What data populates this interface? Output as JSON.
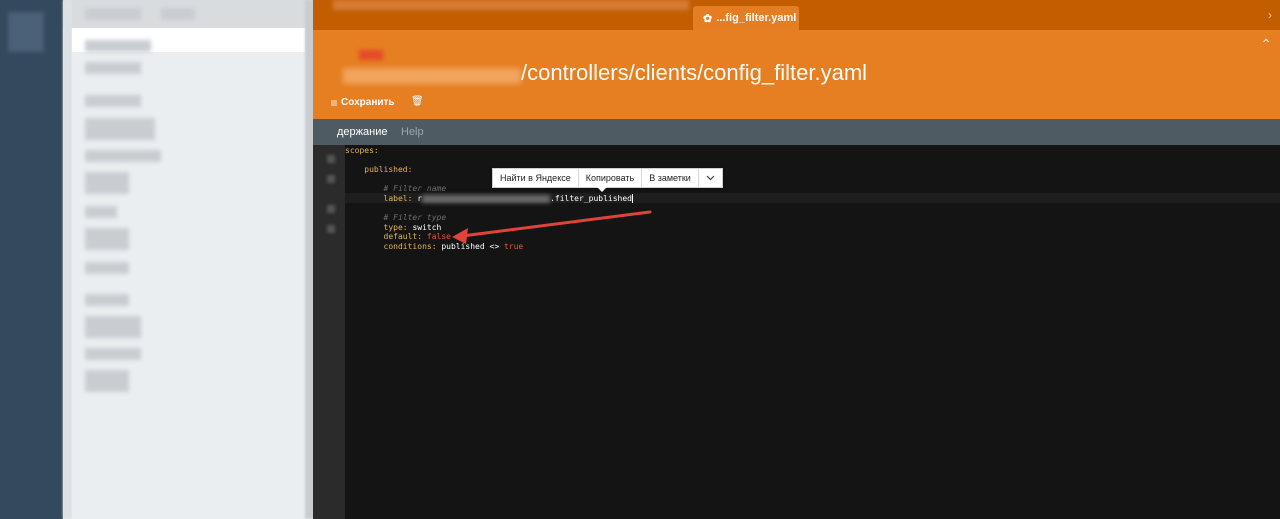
{
  "editor": {
    "tab": {
      "label": "...fig_filter.yaml",
      "icon": "cms-logo-icon"
    },
    "header": {
      "title": "/controllers/clients/config_filter.yaml",
      "save_label": "Сохранить",
      "trash_icon": "trash-icon"
    },
    "subtabs": {
      "active": "держание",
      "help": "Help"
    },
    "code": {
      "scopes_key": "scopes:",
      "published_key": "published:",
      "comment_name": "# Filter name",
      "label_key": "label:",
      "label_prefix": "r",
      "label_suffix": ".filter_published",
      "comment_type": "# Filter type",
      "type_key": "type:",
      "type_value": "switch",
      "default_key": "default:",
      "default_value": "false",
      "conditions_key": "conditions:",
      "conditions_value": "published <>",
      "conditions_bool": "true"
    }
  },
  "context_menu": {
    "items": [
      "Найти в Яндексе",
      "Копировать",
      "В заметки"
    ],
    "expand_icon": "chevron-down-icon"
  },
  "colors": {
    "accent": "#e67e22",
    "tabbar": "#c25e00",
    "code_bg": "#141414",
    "arrow": "#e0433a"
  }
}
